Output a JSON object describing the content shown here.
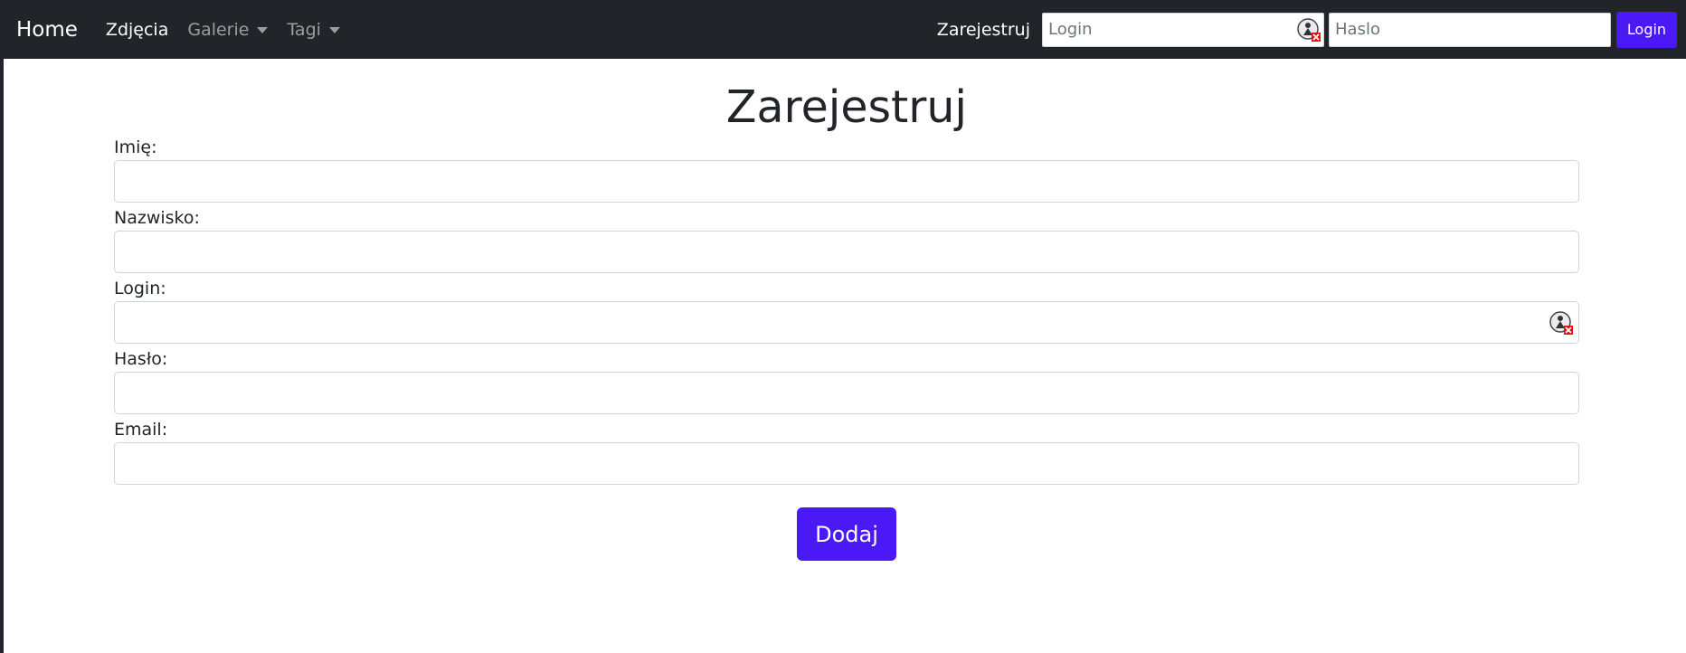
{
  "navbar": {
    "brand": "Home",
    "links": [
      {
        "label": "Zdjęcia",
        "active": true,
        "dropdown": false
      },
      {
        "label": "Galerie",
        "active": false,
        "dropdown": true
      },
      {
        "label": "Tagi",
        "active": false,
        "dropdown": true
      }
    ],
    "register_label": "Zarejestruj",
    "login_placeholder": "Login",
    "password_placeholder": "Haslo",
    "login_button": "Login"
  },
  "form": {
    "title": "Zarejestruj",
    "fields": [
      {
        "label": "Imię:",
        "value": ""
      },
      {
        "label": "Nazwisko:",
        "value": ""
      },
      {
        "label": "Login:",
        "value": ""
      },
      {
        "label": "Hasło:",
        "value": ""
      },
      {
        "label": "Email:",
        "value": ""
      }
    ],
    "submit_label": "Dodaj"
  },
  "colors": {
    "navbar_bg": "#212529",
    "accent": "#4a19f5"
  },
  "icons": [
    "password-manager-icon"
  ]
}
